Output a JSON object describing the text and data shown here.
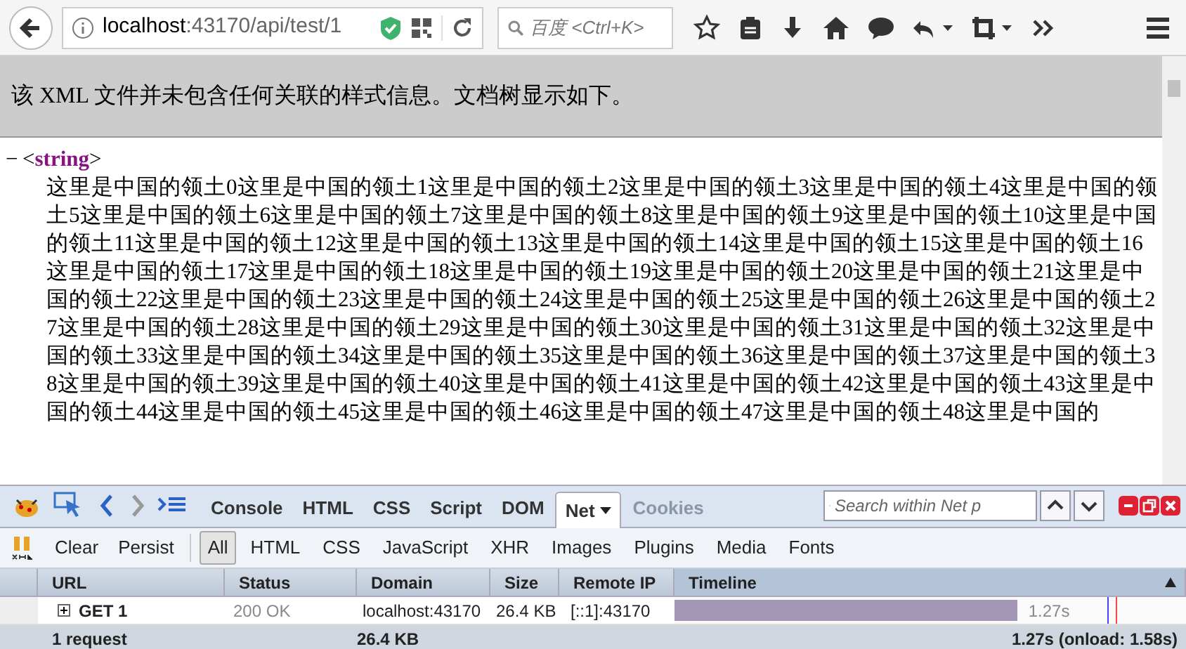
{
  "toolbar": {
    "url_host": "localhost",
    "url_path": ":43170/api/test/1",
    "search_placeholder": "百度 <Ctrl+K>"
  },
  "info": "该 XML 文件并未包含任何关联的样式信息。文档树显示如下。",
  "xml": {
    "toggle": "−",
    "open": "<",
    "tag": "string",
    "close": ">",
    "text": "这里是中国的领土0这里是中国的领土1这里是中国的领土2这里是中国的领土3这里是中国的领土4这里是中国的领土5这里是中国的领土6这里是中国的领土7这里是中国的领土8这里是中国的领土9这里是中国的领土10这里是中国的领土11这里是中国的领土12这里是中国的领土13这里是中国的领土14这里是中国的领土15这里是中国的领土16这里是中国的领土17这里是中国的领土18这里是中国的领土19这里是中国的领土20这里是中国的领土21这里是中国的领土22这里是中国的领土23这里是中国的领土24这里是中国的领土25这里是中国的领土26这里是中国的领土27这里是中国的领土28这里是中国的领土29这里是中国的领土30这里是中国的领土31这里是中国的领土32这里是中国的领土33这里是中国的领土34这里是中国的领土35这里是中国的领土36这里是中国的领土37这里是中国的领土38这里是中国的领土39这里是中国的领土40这里是中国的领土41这里是中国的领土42这里是中国的领土43这里是中国的领土44这里是中国的领土45这里是中国的领土46这里是中国的领土47这里是中国的领土48这里是中国的"
  },
  "devtools": {
    "tabs": [
      {
        "label": "Console",
        "selected": false,
        "disabled": false
      },
      {
        "label": "HTML",
        "selected": false,
        "disabled": false
      },
      {
        "label": "CSS",
        "selected": false,
        "disabled": false
      },
      {
        "label": "Script",
        "selected": false,
        "disabled": false
      },
      {
        "label": "DOM",
        "selected": false,
        "disabled": false
      },
      {
        "label": "Net",
        "selected": true,
        "disabled": false
      },
      {
        "label": "Cookies",
        "selected": false,
        "disabled": true
      }
    ],
    "search_placeholder": "Search within Net p",
    "actions": [
      "Clear",
      "Persist"
    ],
    "filters": [
      {
        "label": "All",
        "selected": true
      },
      {
        "label": "HTML",
        "selected": false
      },
      {
        "label": "CSS",
        "selected": false
      },
      {
        "label": "JavaScript",
        "selected": false
      },
      {
        "label": "XHR",
        "selected": false
      },
      {
        "label": "Images",
        "selected": false
      },
      {
        "label": "Plugins",
        "selected": false
      },
      {
        "label": "Media",
        "selected": false
      },
      {
        "label": "Fonts",
        "selected": false
      }
    ],
    "columns": [
      "URL",
      "Status",
      "Domain",
      "Size",
      "Remote IP",
      "Timeline"
    ],
    "rows": [
      {
        "url": "GET 1",
        "status": "200 OK",
        "domain": "localhost:43170",
        "size": "26.4 KB",
        "remote_ip": "[::1]:43170",
        "level": 0.67,
        "time": "1.27s"
      }
    ],
    "summary": {
      "requests": "1 request",
      "size": "26.4 KB",
      "time": "1.27s (onload: 1.58s)"
    }
  }
}
